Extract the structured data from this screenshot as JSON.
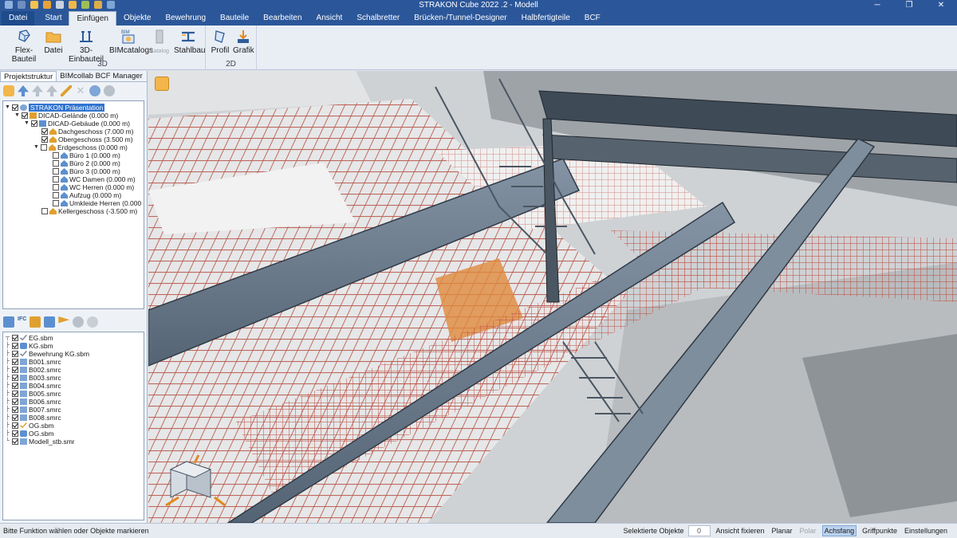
{
  "window": {
    "title": "STRAKON Cube 2022 .2 - Modell"
  },
  "menu_tabs": [
    "Datei",
    "Start",
    "Einfügen",
    "Objekte",
    "Bewehrung",
    "Bauteile",
    "Bearbeiten",
    "Ansicht",
    "Schalbretter",
    "Brücken-/Tunnel-Designer",
    "Halbfertigteile",
    "BCF"
  ],
  "ribbon": {
    "group_3d": {
      "label": "3D",
      "buttons": [
        "Flex-Bauteil",
        "Datei",
        "3D-Einbauteil",
        "BIMcatalogs",
        "Katalog",
        "Stahlbau"
      ],
      "bim_badge": "BIM"
    },
    "group_2d": {
      "label": "2D",
      "buttons": [
        "Profil",
        "Grafik"
      ]
    }
  },
  "left_panel": {
    "tabs": [
      "Projektstruktur",
      "BIMcollab BCF Manager"
    ],
    "project_tree": [
      "STRAKON Präsentation",
      "DICAD-Gelände (0.000 m)",
      "DICAD-Gebäude (0.000 m)",
      "Dachgeschoss (7.000 m)",
      "Obergeschoss (3.500 m)",
      "Erdgeschoss (0.000 m)",
      "Büro 1 (0.000 m)",
      "Büro 2 (0.000 m)",
      "Büro 3 (0.000 m)",
      "WC Damen (0.000 m)",
      "WC Herren (0.000 m)",
      "Aufzug (0.000 m)",
      "Umkleide Herren (0.000 m)",
      "Kellergeschoss (-3.500 m)"
    ],
    "ifc_badge": "IFC",
    "files": [
      "EG.sbm",
      "KG.sbm",
      "Bewehrung KG.sbm",
      "B001.smrc",
      "B002.smrc",
      "B003.smrc",
      "B004.smrc",
      "B005.smrc",
      "B006.smrc",
      "B007.smrc",
      "B008.smrc",
      "OG.sbm",
      "OG.sbm",
      "Modell_stb.smr"
    ]
  },
  "status": {
    "message": "Bitte Funktion wählen oder Objekte markieren",
    "selected_label": "Selektierte Objekte",
    "selected_count": "0",
    "items": [
      "Ansicht fixieren",
      "Planar",
      "Polar",
      "Achsfang",
      "Griffpunkte",
      "Einstellungen"
    ]
  },
  "colors": {
    "accent": "#2b579a",
    "rebar": "#b5483c",
    "steel": "#6f7f8f"
  }
}
